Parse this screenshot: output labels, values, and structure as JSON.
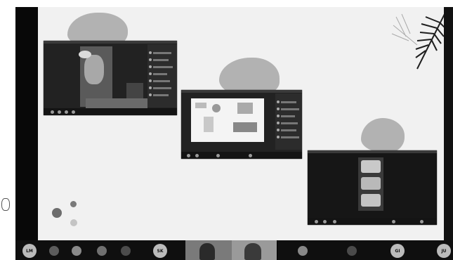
{
  "participants": [
    {
      "initials": "LM"
    },
    {
      "initials": "SK"
    },
    {
      "initials": "GI"
    },
    {
      "initials": "JU"
    }
  ],
  "colors": {
    "slide_background": "#f1f1f1",
    "blob": "#b2b2b2",
    "call_bar": "#0f0f0f",
    "dot_dark": "#6d6d6d",
    "dot_light": "#c4c4c4"
  },
  "icons": [
    "palm-leaf-decoration",
    "circle-dot",
    "video-call-screenshot"
  ]
}
